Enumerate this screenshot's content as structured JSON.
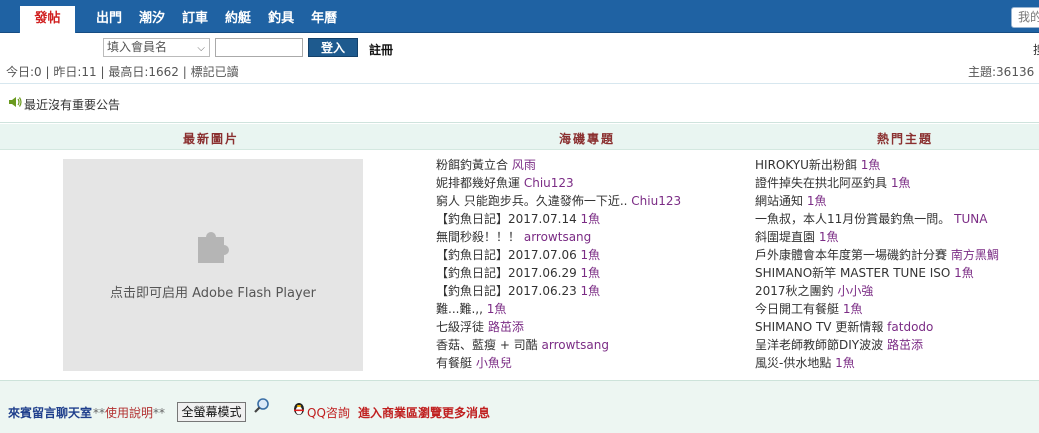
{
  "nav": {
    "post": "發帖",
    "items": [
      "出門",
      "潮汐",
      "訂車",
      "約艇",
      "釣具",
      "年曆"
    ],
    "search_placeholder": "我的"
  },
  "login": {
    "member_select_placeholder": "填入會員名",
    "login_button": "登入",
    "register": "註冊",
    "edge_char": "搜"
  },
  "stats": {
    "text": "今日:0 | 昨日:11 | 最高日:1662 | 標記已讀",
    "topics": "主題:36136"
  },
  "announcement": {
    "text": "最近沒有重要公告"
  },
  "columns": {
    "latest_images": "最新圖片",
    "sea_fishing": "海磯專題",
    "hot_topics": "熱門主題"
  },
  "flash": {
    "text": "点击即可启用 Adobe Flash Player"
  },
  "sea_fishing_items": [
    {
      "title": "粉餌釣黃立合",
      "fish": "",
      "author": "风雨"
    },
    {
      "title": "妮排都幾好魚運",
      "fish": "",
      "author": "Chiu123"
    },
    {
      "title": "窮人 只能跑步兵。久違發佈一下近..",
      "fish": "",
      "author": "Chiu123"
    },
    {
      "title": "【釣魚日記】2017.07.14",
      "fish": "1魚",
      "author": ""
    },
    {
      "title": "無間秒殺！！！",
      "fish": "",
      "author": "arrowtsang"
    },
    {
      "title": "【釣魚日記】2017.07.06",
      "fish": "1魚",
      "author": ""
    },
    {
      "title": "【釣魚日記】2017.06.29",
      "fish": "1魚",
      "author": ""
    },
    {
      "title": "【釣魚日記】2017.06.23",
      "fish": "1魚",
      "author": ""
    },
    {
      "title": "難...難.,,",
      "fish": "1魚",
      "author": ""
    },
    {
      "title": "七級浮徒",
      "fish": "",
      "author": "路茁添"
    },
    {
      "title": "香菇、藍瘦 + 司酷",
      "fish": "",
      "author": "arrowtsang"
    },
    {
      "title": "有餐艇",
      "fish": "",
      "author": "小魚兒"
    }
  ],
  "hot_topic_items": [
    {
      "title": "HIROKYU新出粉餌",
      "fish": "1魚",
      "author": ""
    },
    {
      "title": "證件掉失在拱北阿巫釣具",
      "fish": "1魚",
      "author": ""
    },
    {
      "title": "網站通知",
      "fish": "1魚",
      "author": ""
    },
    {
      "title": "一魚叔，本人11月份賞最釣魚一問。",
      "fish": "",
      "author": "TUNA"
    },
    {
      "title": "斜圍堤直園",
      "fish": "1魚",
      "author": ""
    },
    {
      "title": "戶外康體會本年度第一場磯釣計分賽",
      "fish": "",
      "author": "南方黑鯛"
    },
    {
      "title": "SHIMANO新竿 MASTER TUNE ISO",
      "fish": "1魚",
      "author": ""
    },
    {
      "title": "2017秋之團釣",
      "fish": "",
      "author": "小小強"
    },
    {
      "title": "今日開工有餐艇",
      "fish": "1魚",
      "author": ""
    },
    {
      "title": "SHIMANO TV 更新情報",
      "fish": "",
      "author": "fatdodo"
    },
    {
      "title": "呈洋老師教師節DIY波波",
      "fish": "",
      "author": "路茁添"
    },
    {
      "title": "風災-供水地點",
      "fish": "1魚",
      "author": ""
    }
  ],
  "bottom": {
    "guest_chat": "來賓留言聊天室",
    "usage_stars_left": "**",
    "usage": "使用說明",
    "usage_stars_right": "**",
    "fullscreen_button": "全螢幕模式",
    "qq": "QQ咨詢",
    "business": "進入商業區瀏覽更多消息"
  },
  "colors": {
    "nav_bg": "#1f62a3",
    "post_red": "#d01f1f",
    "section_title": "#8a2f2f",
    "author_purple": "#7b2c85",
    "business_red": "#c02020"
  }
}
